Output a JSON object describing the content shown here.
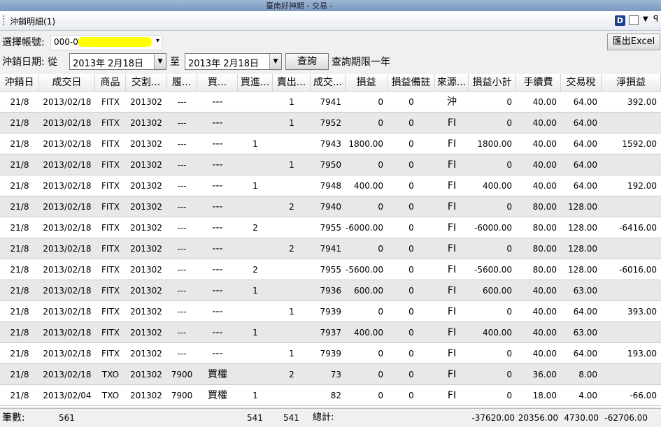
{
  "window": {
    "title": "臺南好神期 - 交易 -"
  },
  "panel": {
    "title": "沖銷明細(1)",
    "toolbar_icon_letter": "D"
  },
  "account": {
    "label": "選擇帳號:",
    "value": "000-0",
    "redacted": true
  },
  "export_button": "匯出Excel",
  "date_filter": {
    "label": "沖銷日期: 從",
    "from": "2013年  2月18日",
    "to_label": "至",
    "to": "2013年  2月18日",
    "query_button": "查詢",
    "hint": "查詢期限一年"
  },
  "table": {
    "columns": [
      "沖銷日",
      "成交日",
      "商品",
      "交割...",
      "履...",
      "買...",
      "買進...",
      "賣出...",
      "成交...",
      "損益",
      "損益備註",
      "來源...",
      "損益小計",
      "手續費",
      "交易稅",
      "淨損益"
    ],
    "rows": [
      [
        "21/8",
        "2013/02/18",
        "FITX",
        "201302",
        "---",
        "---",
        "",
        "1",
        "7941",
        "0",
        "0",
        "沖",
        "0",
        "40.00",
        "64.00",
        "392.00"
      ],
      [
        "21/8",
        "2013/02/18",
        "FITX",
        "201302",
        "---",
        "---",
        "",
        "1",
        "7952",
        "0",
        "0",
        "FI",
        "0",
        "40.00",
        "64.00",
        ""
      ],
      [
        "21/8",
        "2013/02/18",
        "FITX",
        "201302",
        "---",
        "---",
        "1",
        "",
        "7943",
        "1800.00",
        "0",
        "FI",
        "1800.00",
        "40.00",
        "64.00",
        "1592.00"
      ],
      [
        "21/8",
        "2013/02/18",
        "FITX",
        "201302",
        "---",
        "---",
        "",
        "1",
        "7950",
        "0",
        "0",
        "FI",
        "0",
        "40.00",
        "64.00",
        ""
      ],
      [
        "21/8",
        "2013/02/18",
        "FITX",
        "201302",
        "---",
        "---",
        "1",
        "",
        "7948",
        "400.00",
        "0",
        "FI",
        "400.00",
        "40.00",
        "64.00",
        "192.00"
      ],
      [
        "21/8",
        "2013/02/18",
        "FITX",
        "201302",
        "---",
        "---",
        "",
        "2",
        "7940",
        "0",
        "0",
        "FI",
        "0",
        "80.00",
        "128.00",
        ""
      ],
      [
        "21/8",
        "2013/02/18",
        "FITX",
        "201302",
        "---",
        "---",
        "2",
        "",
        "7955",
        "-6000.00",
        "0",
        "FI",
        "-6000.00",
        "80.00",
        "128.00",
        "-6416.00"
      ],
      [
        "21/8",
        "2013/02/18",
        "FITX",
        "201302",
        "---",
        "---",
        "",
        "2",
        "7941",
        "0",
        "0",
        "FI",
        "0",
        "80.00",
        "128.00",
        ""
      ],
      [
        "21/8",
        "2013/02/18",
        "FITX",
        "201302",
        "---",
        "---",
        "2",
        "",
        "7955",
        "-5600.00",
        "0",
        "FI",
        "-5600.00",
        "80.00",
        "128.00",
        "-6016.00"
      ],
      [
        "21/8",
        "2013/02/18",
        "FITX",
        "201302",
        "---",
        "---",
        "1",
        "",
        "7936",
        "600.00",
        "0",
        "FI",
        "600.00",
        "40.00",
        "63.00",
        ""
      ],
      [
        "21/8",
        "2013/02/18",
        "FITX",
        "201302",
        "---",
        "---",
        "",
        "1",
        "7939",
        "0",
        "0",
        "FI",
        "0",
        "40.00",
        "64.00",
        "393.00"
      ],
      [
        "21/8",
        "2013/02/18",
        "FITX",
        "201302",
        "---",
        "---",
        "1",
        "",
        "7937",
        "400.00",
        "0",
        "FI",
        "400.00",
        "40.00",
        "63.00",
        ""
      ],
      [
        "21/8",
        "2013/02/18",
        "FITX",
        "201302",
        "---",
        "---",
        "",
        "1",
        "7939",
        "0",
        "0",
        "FI",
        "0",
        "40.00",
        "64.00",
        "193.00"
      ],
      [
        "21/8",
        "2013/02/18",
        "TXO",
        "201302",
        "7900",
        "買權",
        "",
        "2",
        "73",
        "0",
        "0",
        "FI",
        "0",
        "36.00",
        "8.00",
        ""
      ],
      [
        "21/8",
        "2013/02/04",
        "TXO",
        "201302",
        "7900",
        "買權",
        "1",
        "",
        "82",
        "0",
        "0",
        "FI",
        "0",
        "18.00",
        "4.00",
        "-66.00"
      ]
    ]
  },
  "footer": {
    "count_label": "筆數:",
    "count": "561",
    "buy_total": "541",
    "sell_total": "541",
    "total_label": "總計:",
    "pnl_subtotal": "-37620.00",
    "fee": "20356.00",
    "tax": "4730.00",
    "net": "-62706.00"
  }
}
